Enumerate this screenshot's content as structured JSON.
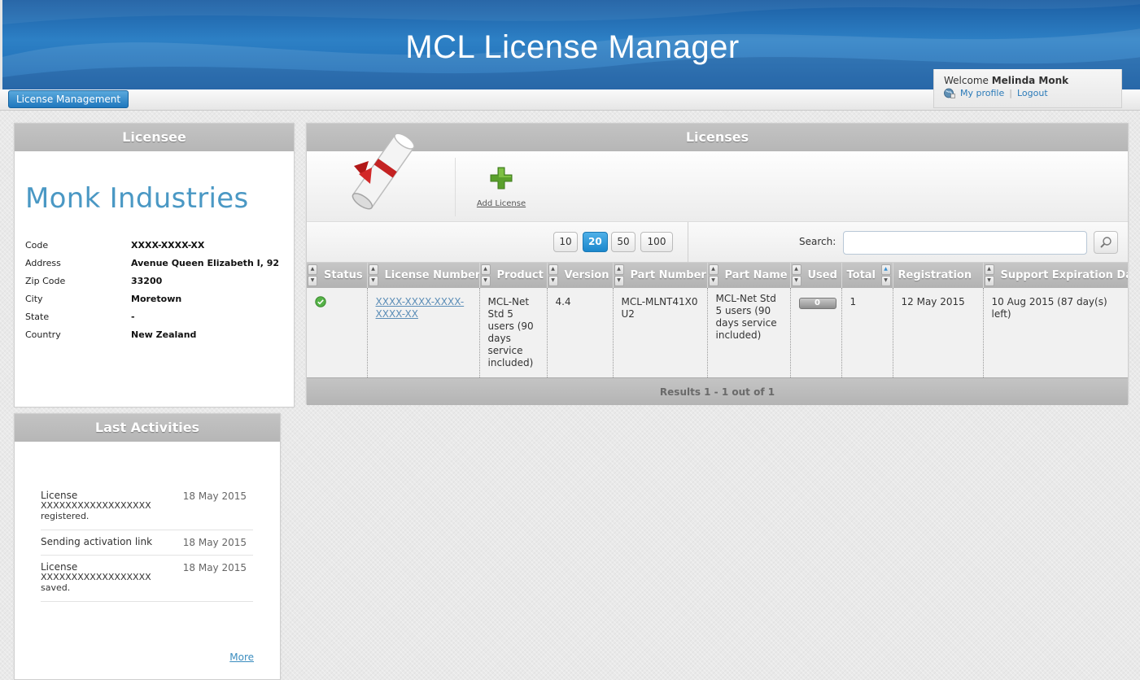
{
  "header": {
    "app_title": "MCL License Manager",
    "brand_color": "#1f6fb5"
  },
  "nav": {
    "license_management_label": "License Management"
  },
  "welcome": {
    "prefix": "Welcome",
    "user_name": "Melinda Monk",
    "my_profile_label": "My profile",
    "separator": "|",
    "logout_label": "Logout"
  },
  "licensee": {
    "title": "Licensee",
    "company_name": "Monk Industries",
    "fields": [
      {
        "key": "Code",
        "value": "XXXX-XXXX-XX"
      },
      {
        "key": "Address",
        "value": "Avenue Queen Elizabeth I, 92"
      },
      {
        "key": "Zip Code",
        "value": "33200"
      },
      {
        "key": "City",
        "value": "Moretown"
      },
      {
        "key": "State",
        "value": "-"
      },
      {
        "key": "Country",
        "value": "New Zealand"
      }
    ]
  },
  "activities": {
    "title": "Last Activities",
    "items": [
      {
        "line1": "License",
        "line2": "XXXXXXXXXXXXXXXXXX registered.",
        "date": "18 May 2015"
      },
      {
        "line1": "Sending activation link",
        "line2": "",
        "date": "18 May 2015"
      },
      {
        "line1": "License",
        "line2": "XXXXXXXXXXXXXXXXXX saved.",
        "date": "18 May 2015"
      }
    ],
    "more_label": "More"
  },
  "licenses": {
    "title": "Licenses",
    "add_license_label": "Add License",
    "page_sizes": [
      "10",
      "20",
      "50",
      "100"
    ],
    "active_page_size": "20",
    "search_label": "Search:",
    "search_value": "",
    "columns": [
      "Status",
      "License Number",
      "Product",
      "Version",
      "Part Number",
      "Part Name",
      "Used",
      "Total",
      "Registration",
      "Support Expiration Date"
    ],
    "rows": [
      {
        "status": "active",
        "license_number": "XXXX-XXXX-XXXX-XXXX-XX",
        "product": "MCL-Net Std 5 users (90 days service included)",
        "version": "4.4",
        "part_number": "MCL-MLNT41X0U2",
        "part_name": "MCL-Net Std 5 users (90 days service included)",
        "used": "0",
        "total": "1",
        "registration": "12 May 2015",
        "support_expiration": "10 Aug 2015 (87 day(s) left)"
      }
    ],
    "results_text": "Results 1 - 1 out of 1"
  }
}
